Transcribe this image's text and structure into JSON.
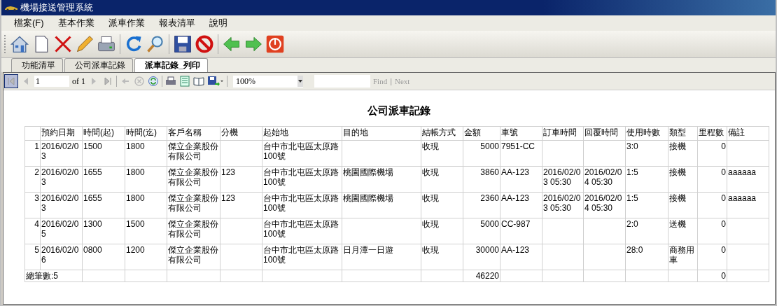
{
  "window": {
    "title": "機場接送管理系統"
  },
  "menu": [
    "檔案(F)",
    "基本作業",
    "派車作業",
    "報表清單",
    "說明"
  ],
  "tabs": [
    {
      "label": "功能清單",
      "selected": false
    },
    {
      "label": "公司派車記錄",
      "selected": false
    },
    {
      "label": "派車記錄_列印",
      "selected": true
    }
  ],
  "report_toolbar": {
    "page": "1",
    "of": "of 1",
    "zoom": "100%",
    "find": "Find",
    "separator": "|",
    "next": "Next"
  },
  "report": {
    "title": "公司派車記錄",
    "columns": [
      null,
      "預約日期",
      "時間(起)",
      "時間(迄)",
      "客戶名稱",
      "分機",
      "起始地",
      "目的地",
      "結帳方式",
      "金額",
      "車號",
      "訂車時間",
      "回覆時間",
      "使用時數",
      "類型",
      "里程數",
      "備註"
    ],
    "rows": [
      [
        "1",
        "2016/02/03",
        "1500",
        "1800",
        "傑立企業股份有限公司",
        null,
        "台中市北屯區太原路100號",
        null,
        "收現",
        "5000",
        "7951-CC",
        null,
        null,
        "3:0",
        "接機",
        "0",
        null
      ],
      [
        "2",
        "2016/02/03",
        "1655",
        "1800",
        "傑立企業股份有限公司",
        "123",
        "台中市北屯區太原路100號",
        "桃園國際機場",
        "收現",
        "3860",
        "AA-123",
        "2016/02/03 05:30",
        "2016/02/04 05:30",
        "1:5",
        "接機",
        "0",
        "aaaaaa"
      ],
      [
        "3",
        "2016/02/03",
        "1655",
        "1800",
        "傑立企業股份有限公司",
        "123",
        "台中市北屯區太原路100號",
        "桃園國際機場",
        "收現",
        "2360",
        "AA-123",
        "2016/02/03 05:30",
        "2016/02/04 05:30",
        "1:5",
        "接機",
        "0",
        "aaaaaa"
      ],
      [
        "4",
        "2016/02/05",
        "1300",
        "1500",
        "傑立企業股份有限公司",
        null,
        "台中市北屯區太原路100號",
        null,
        "收現",
        "5000",
        "CC-987",
        null,
        null,
        "2:0",
        "送機",
        "0",
        null
      ],
      [
        "5",
        "2016/02/06",
        "0800",
        "1200",
        "傑立企業股份有限公司",
        null,
        "台中市北屯區太原路100號",
        "日月潭一日遊",
        "收現",
        "30000",
        "AA-123",
        null,
        null,
        "28:0",
        "商務用車",
        "0",
        null
      ]
    ],
    "totals": {
      "label": "總筆數:5",
      "amount": "46220",
      "mileage": "0"
    }
  }
}
